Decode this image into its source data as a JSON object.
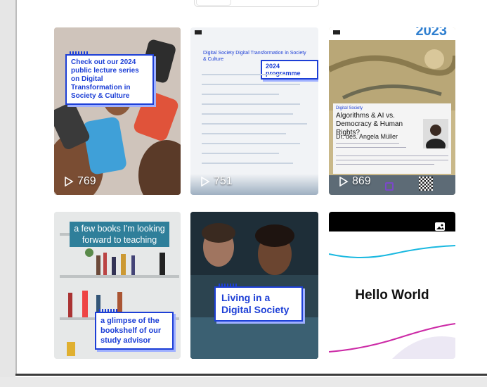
{
  "posts": [
    {
      "headline": "Check out our 2024 public lecture series on Digital Transformation in Society & Culture",
      "views": "769"
    },
    {
      "programme_title": "Digital Society Digital Transformation in Society & Culture",
      "badge": "2024 programme",
      "views": "751"
    },
    {
      "year": "2023",
      "category": "Digital Society",
      "title": "Algorithms & AI vs. Democracy & Human Rights?",
      "speaker": "Dr. des. Angela Müller",
      "views": "869"
    },
    {
      "top_caption": "a few books I'm looking forward to teaching",
      "bottom_caption": "a glimpse of the bookshelf of our study advisor"
    },
    {
      "headline": "Living in a Digital Society"
    },
    {
      "headline": "Hello World",
      "type_icon": "image-icon"
    }
  ],
  "colors": {
    "accent_blue": "#1d3fd6",
    "teal": "#2f7f9a"
  }
}
